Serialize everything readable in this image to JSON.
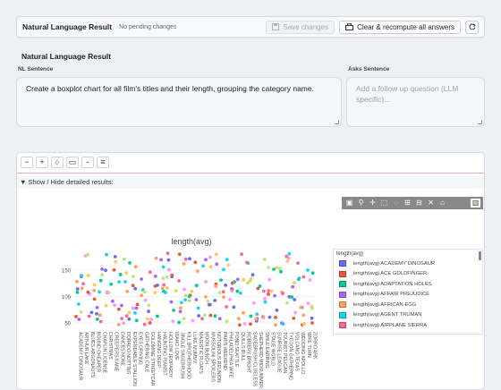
{
  "topbar": {
    "title": "Natural Language Result",
    "status": "No pending changes",
    "save_label": "Save changes",
    "recompute_label": "Clear & recompute all answers"
  },
  "section_title": "Natural Language Result",
  "nl": {
    "label": "NL Sentence",
    "value": "Create a boxplot chart for all film's titles and their length, grouping the category name."
  },
  "asks": {
    "label": "Asks Sentence",
    "placeholder": "Add a follow up question (LLM specific)..."
  },
  "toggle_label": "▼ Show / Hide detailed results:",
  "chart_data": {
    "type": "scatter",
    "title": "length(avg)",
    "y_ticks": [
      50,
      100,
      150
    ],
    "ylim": [
      40,
      185
    ],
    "categories": [
      "ACADEMY DINOSAUR",
      "ARTHUR LAKE",
      "BLUES ARGONAUTS",
      "BOUND CHEAPER",
      "CHAPLIN LICENSE",
      "CHRISTMAS",
      "CREEPERS KANE",
      "DANCES NONE",
      "DORADO NOTTING",
      "EXPENDABLE STALLION",
      "EYES DRIVING",
      "GATHERING CALE",
      "GOLDMINE STREETCAR",
      "HANGING DEEP",
      "HAUNTING PIANIST",
      "HOLLOW JEOPARDY",
      "IDAHO LOVE",
      "JINGLE SAGEBRUSH",
      "KILL BROTHERHOOD",
      "LUKE MUMMY",
      "MAJESTIC FLOATS",
      "MOON BUNCH",
      "MUSSOLINI SPOILERS",
      "NOTORIOUS REUNION",
      "PARIS WEEKEND",
      "PHILADELPHIA WIFE",
      "POND SEATTLE",
      "QUILLS BULL",
      "ROBBERY BRIGHT",
      "SAGEBRUSH CLUELESS",
      "SHEPHERD MIDSUMMER",
      "SMILE EARRING",
      "STAGE WORLD",
      "SUNRISE LEAGUE",
      "TOURIST PELICAN",
      "TYCOON GATHERING",
      "VOLCANO TEXAS",
      "WEDDING APOLLO",
      "WIFE TURN",
      "ZORRO ARK"
    ],
    "points_per_category": 6,
    "legend_title": "length(avg)",
    "legend_items": [
      {
        "label": "length(avg) ACADEMY DINOSAUR",
        "color": "#636efa"
      },
      {
        "label": "length(avg) ACE GOLDFINGER",
        "color": "#ef553b"
      },
      {
        "label": "length(avg) ADAPTATION HOLES",
        "color": "#00cc96"
      },
      {
        "label": "length(avg) AFFAIR PREJUDICE",
        "color": "#ab63fa"
      },
      {
        "label": "length(avg) AFRICAN EGG",
        "color": "#ffa15a"
      },
      {
        "label": "length(avg) AGENT TRUMAN",
        "color": "#19d3f3"
      },
      {
        "label": "length(avg) AIRPLANE SIERRA",
        "color": "#ff6692"
      }
    ],
    "palette": [
      "#636efa",
      "#ef553b",
      "#00cc96",
      "#ab63fa",
      "#ffa15a",
      "#19d3f3",
      "#ff6692",
      "#b6e880",
      "#ff97ff",
      "#fecb52"
    ]
  }
}
